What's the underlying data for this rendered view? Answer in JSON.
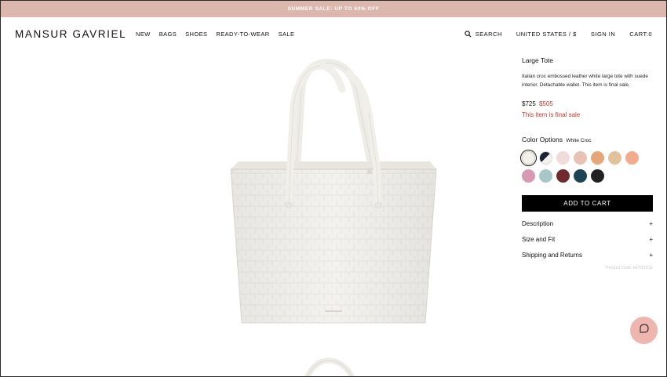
{
  "promo": {
    "text": "SUMMER SALE: UP TO 60% OFF"
  },
  "header": {
    "logo": "MANSUR GAVRIEL",
    "nav": [
      "NEW",
      "BAGS",
      "SHOES",
      "READY-TO-WEAR",
      "SALE"
    ],
    "search_label": "SEARCH",
    "region": "UNITED STATES / $",
    "sign_in": "SIGN IN",
    "cart": "CART:0"
  },
  "product": {
    "title": "Large Tote",
    "description": "Italian croc embossed leather white large tote with suede interior. Detachable wallet. This item is final sale.",
    "price_original": "$725",
    "price_sale": "$505",
    "final_sale_note": "This item is final sale",
    "color_label": "Color Options",
    "color_selected": "White Croc",
    "swatches": [
      {
        "name": "white-croc",
        "color": "#f3f1ec",
        "selected": true
      },
      {
        "name": "black-white",
        "color": "split"
      },
      {
        "name": "blush",
        "color": "#f2dcdb"
      },
      {
        "name": "pink-speckle",
        "color": "#e8c2b5"
      },
      {
        "name": "tan-speckle",
        "color": "#e5a77a"
      },
      {
        "name": "camel",
        "color": "#e2c29a"
      },
      {
        "name": "peach",
        "color": "#f5aa8e"
      },
      {
        "name": "pink-glitter",
        "color": "#d89ab2"
      },
      {
        "name": "sage-blue",
        "color": "#a8c7c8"
      },
      {
        "name": "oxblood",
        "color": "#6e2a2d"
      },
      {
        "name": "teal",
        "color": "#1c4455"
      },
      {
        "name": "black",
        "color": "#222222"
      }
    ],
    "add_to_cart": "ADD TO CART",
    "accordion": [
      "Description",
      "Size and Fit",
      "Shipping and Returns"
    ],
    "product_code": "Product Code: HLT001CE"
  },
  "colors": {
    "promo_bg": "#dbb7ad",
    "sale_red": "#d0342c",
    "chat_bg": "#efb6b0"
  },
  "icons": {
    "search": "search-icon",
    "chat": "chat-icon"
  }
}
